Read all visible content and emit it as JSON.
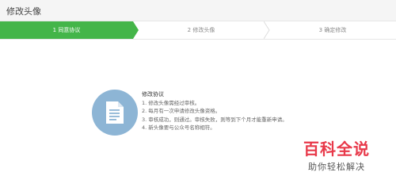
{
  "header": {
    "title": "修改头像"
  },
  "steps": [
    {
      "label": "1 同意协议",
      "active": true
    },
    {
      "label": "2 修改头像",
      "active": false
    },
    {
      "label": "3 确定修改",
      "active": false
    }
  ],
  "agreement": {
    "icon": "document-icon",
    "title": "修改协议",
    "items": [
      "1. 修改头像需经过审核。",
      "2. 每月有一次申请修改头像资格。",
      "3. 审核成功，则通过。审核失败，则等到下个月才能重新申请。",
      "4. 新头像要与公众号名称相符。"
    ]
  },
  "watermark": {
    "title": "百科全说",
    "subtitle": "助你轻松解决"
  },
  "colors": {
    "active_step": "#44b549",
    "icon_circle": "#8db5d5",
    "watermark": "#e8394a"
  }
}
